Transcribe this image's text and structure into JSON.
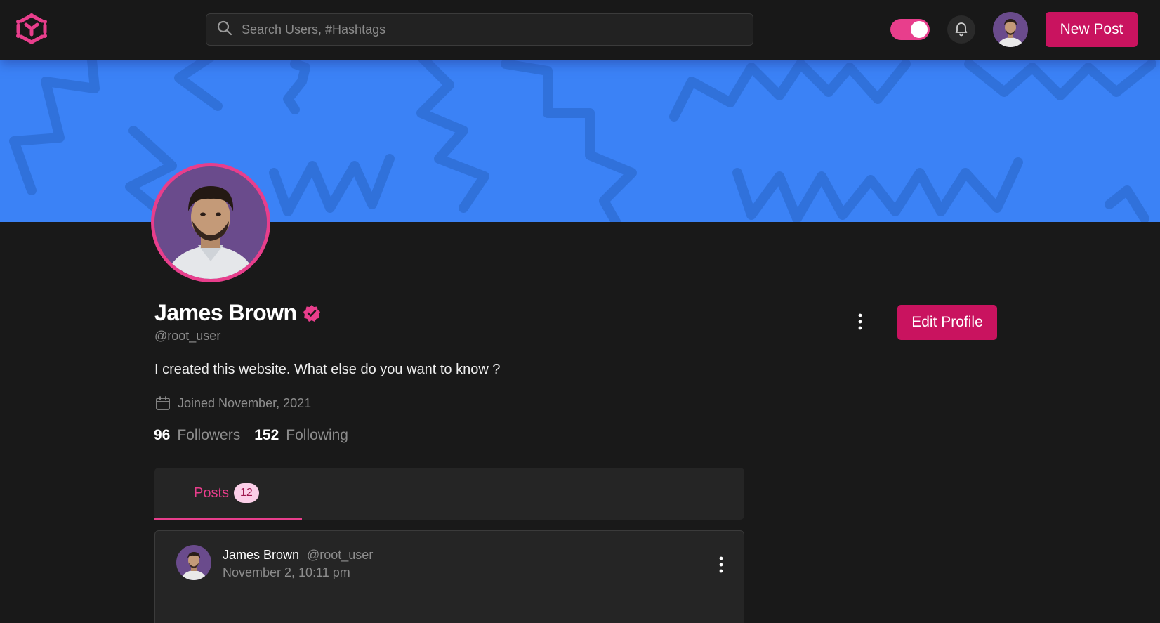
{
  "header": {
    "search_placeholder": "Search Users, #Hashtags",
    "theme_toggle_on": true,
    "new_post_label": "New Post"
  },
  "profile": {
    "name": "James Brown",
    "handle": "@root_user",
    "bio": "I created this website. What else do you want to know ?",
    "joined": "Joined November, 2021",
    "followers_count": "96",
    "followers_label": "Followers",
    "following_count": "152",
    "following_label": "Following",
    "edit_label": "Edit Profile",
    "verified": true
  },
  "tabs": [
    {
      "label": "Posts",
      "count": "12",
      "active": true
    }
  ],
  "posts": [
    {
      "author": "James Brown",
      "handle": "@root_user",
      "date": "November 2, 10:11 pm"
    }
  ],
  "colors": {
    "accent": "#e83e8c",
    "button": "#c9135f",
    "banner": "#3b82f6",
    "background": "#191919"
  },
  "icons": {
    "logo": "hexagon-logo-icon",
    "search": "search-icon",
    "bell": "bell-icon",
    "verified": "verified-badge-icon",
    "calendar": "calendar-icon",
    "menu": "kebab-menu-icon"
  }
}
